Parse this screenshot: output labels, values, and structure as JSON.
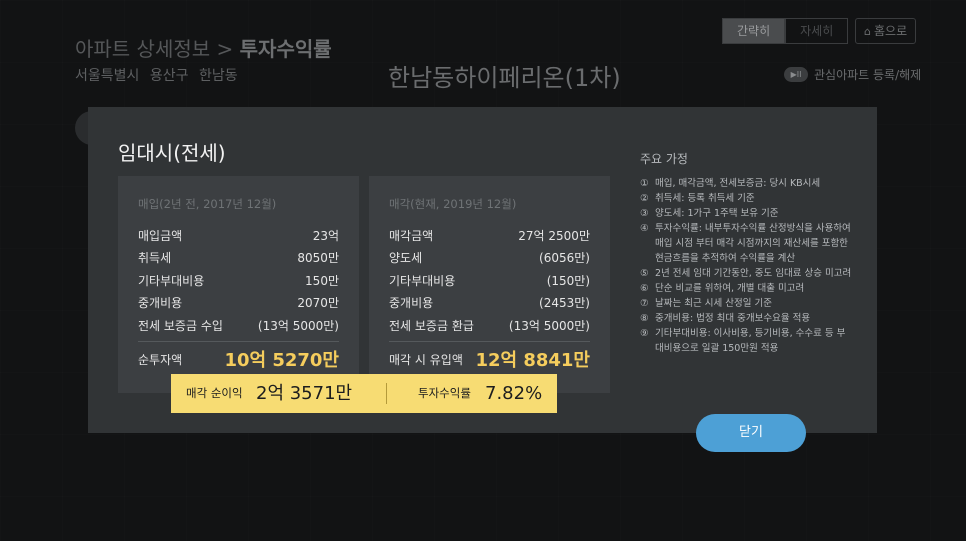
{
  "background_page": {
    "breadcrumb_parent": "아파트 상세정보 >",
    "breadcrumb_current": "투자수익률",
    "region": [
      "서울특별시",
      "용산구",
      "한남동"
    ],
    "apartment_name": "한남동하이페리온(1차)",
    "view_simple": "간략히",
    "view_detail": "자세히",
    "home_label": "홈으로",
    "home_icon": "home-icon",
    "favorite_label": "관심아파트 등록/해제",
    "favorite_icon_glyph": "▶II"
  },
  "modal": {
    "title": "임대시(전세)",
    "buy_card": {
      "header": "매입(2년 전, 2017년 12월)",
      "rows": [
        {
          "label": "매입금액",
          "value": "23억"
        },
        {
          "label": "취득세",
          "value": "8050만"
        },
        {
          "label": "기타부대비용",
          "value": "150만"
        },
        {
          "label": "중개비용",
          "value": "2070만"
        },
        {
          "label": "전세 보증금 수입",
          "value": "(13억 5000만)"
        }
      ],
      "total_label": "순투자액",
      "total_value": "10억 5270만"
    },
    "sell_card": {
      "header": "매각(현재, 2019년 12월)",
      "rows": [
        {
          "label": "매각금액",
          "value": "27억 2500만"
        },
        {
          "label": "양도세",
          "value": "(6056만)"
        },
        {
          "label": "기타부대비용",
          "value": "(150만)"
        },
        {
          "label": "중개비용",
          "value": "(2453만)"
        },
        {
          "label": "전세 보증금 환급",
          "value": "(13억 5000만)"
        }
      ],
      "total_label": "매각 시 유입액",
      "total_value": "12억 8841만"
    },
    "result": {
      "net_label": "매각 순이익",
      "net_value": "2억 3571만",
      "rate_label": "투자수익률",
      "rate_value": "7.82%"
    },
    "assumptions_title": "주요 가정",
    "assumptions": [
      {
        "num": "①",
        "text": "매입, 매각금액, 전세보증금: 당시 KB시세"
      },
      {
        "num": "②",
        "text": "취득세: 등록 취득세 기준"
      },
      {
        "num": "③",
        "text": "양도세: 1가구 1주택 보유 기준"
      },
      {
        "num": "④",
        "text": "투자수익률: 내부투자수익률 산정방식을 사용하여 매입 시점 부터 매각 시점까지의 재산세를 포함한 현금흐름을 추적하여 수익률을 계산"
      },
      {
        "num": "⑤",
        "text": "2년 전세 임대 기간동안, 중도 임대료 상승 미고려"
      },
      {
        "num": "⑥",
        "text": "단순 비교를 위하여, 개별 대출 미고려"
      },
      {
        "num": "⑦",
        "text": "날짜는 최근 시세 산정일 기준"
      },
      {
        "num": "⑧",
        "text": "중개비용: 법정 최대 중개보수요율 적용"
      },
      {
        "num": "⑨",
        "text": "기타부대비용: 이사비용, 등기비용, 수수료 등 부대비용으로 일괄 150만원 적용"
      }
    ],
    "close_label": "닫기"
  },
  "colors": {
    "modal_bg": "#313436",
    "card_bg": "#3c3f42",
    "highlight_yellow": "#f5cd5d",
    "result_bar": "#f7dc73",
    "close_button": "#4da0d6"
  }
}
